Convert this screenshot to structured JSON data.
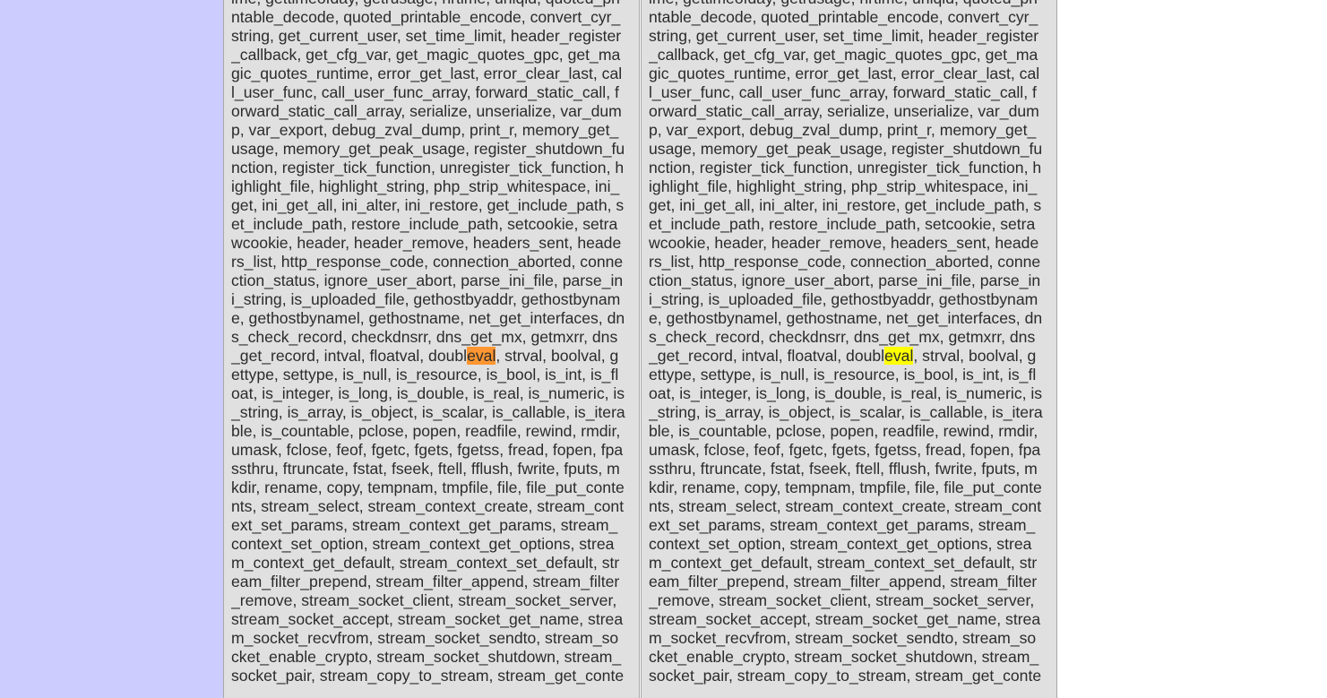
{
  "find": {
    "term": "eval"
  },
  "colors": {
    "page_left_background": "#ccccff",
    "panel_background": "#e0e0e0",
    "current_match_highlight": "#ff9632",
    "other_match_highlight": "#ffff00"
  },
  "left_panel": {
    "lines_before_match": [
      "ime, gettimeofday, getrusage, hrtime, uniqid, quoted_pri",
      "ntable_decode, quoted_printable_encode, convert_cyr_",
      "string, get_current_user, set_time_limit, header_register",
      "_callback, get_cfg_var, get_magic_quotes_gpc, get_ma",
      "gic_quotes_runtime, error_get_last, error_clear_last, cal",
      "l_user_func, call_user_func_array, forward_static_call, f",
      "orward_static_call_array, serialize, unserialize, var_dum",
      "p, var_export, debug_zval_dump, print_r, memory_get_",
      "usage, memory_get_peak_usage, register_shutdown_fu",
      "nction, register_tick_function, unregister_tick_function, h",
      "ighlight_file, highlight_string, php_strip_whitespace, ini_",
      "get, ini_get_all, ini_alter, ini_restore, get_include_path, s",
      "et_include_path, restore_include_path, setcookie, setra",
      "wcookie, header, header_remove, headers_sent, heade",
      "rs_list, http_response_code, connection_aborted, conne",
      "ction_status, ignore_user_abort, parse_ini_file, parse_in",
      "i_string, is_uploaded_file, gethostbyaddr, gethostbynam",
      "e, gethostbynamel, gethostname, net_get_interfaces, dn",
      "s_check_record, checkdnsrr, dns_get_mx, getmxrr, dns"
    ],
    "match_line": {
      "before": "_get_record, intval, floatval, doubl",
      "match": "eval",
      "after": ", strval, boolval, g"
    },
    "lines_after_match": [
      "ettype, settype, is_null, is_resource, is_bool, is_int, is_fl",
      "oat, is_integer, is_long, is_double, is_real, is_numeric, is",
      "_string, is_array, is_object, is_scalar, is_callable, is_itera",
      "ble, is_countable, pclose, popen, readfile, rewind, rmdir,",
      "umask, fclose, feof, fgetc, fgets, fgetss, fread, fopen, fpa",
      "ssthru, ftruncate, fstat, fseek, ftell, fflush, fwrite, fputs, m",
      "kdir, rename, copy, tempnam, tmpfile, file, file_put_conte",
      "nts, stream_select, stream_context_create, stream_cont",
      "ext_set_params, stream_context_get_params, stream_",
      "context_set_option, stream_context_get_options, strea",
      "m_context_get_default, stream_context_set_default, str",
      "eam_filter_prepend, stream_filter_append, stream_filter",
      "_remove, stream_socket_client, stream_socket_server,",
      "stream_socket_accept, stream_socket_get_name, strea",
      "m_socket_recvfrom, stream_socket_sendto, stream_so",
      "cket_enable_crypto, stream_socket_shutdown, stream_",
      "socket_pair, stream_copy_to_stream, stream_get_conte"
    ]
  },
  "right_panel": {
    "lines_before_match": [
      "ime, gettimeofday, getrusage, hrtime, uniqid, quoted_pri",
      "ntable_decode, quoted_printable_encode, convert_cyr_",
      "string, get_current_user, set_time_limit, header_register",
      "_callback, get_cfg_var, get_magic_quotes_gpc, get_ma",
      "gic_quotes_runtime, error_get_last, error_clear_last, cal",
      "l_user_func, call_user_func_array, forward_static_call, f",
      "orward_static_call_array, serialize, unserialize, var_dum",
      "p, var_export, debug_zval_dump, print_r, memory_get_",
      "usage, memory_get_peak_usage, register_shutdown_fu",
      "nction, register_tick_function, unregister_tick_function, h",
      "ighlight_file, highlight_string, php_strip_whitespace, ini_",
      "get, ini_get_all, ini_alter, ini_restore, get_include_path, s",
      "et_include_path, restore_include_path, setcookie, setra",
      "wcookie, header, header_remove, headers_sent, heade",
      "rs_list, http_response_code, connection_aborted, conne",
      "ction_status, ignore_user_abort, parse_ini_file, parse_in",
      "i_string, is_uploaded_file, gethostbyaddr, gethostbynam",
      "e, gethostbynamel, gethostname, net_get_interfaces, dn",
      "s_check_record, checkdnsrr, dns_get_mx, getmxrr, dns"
    ],
    "match_line": {
      "before": "_get_record, intval, floatval, doubl",
      "match": "eval",
      "after": ", strval, boolval, g"
    },
    "lines_after_match": [
      "ettype, settype, is_null, is_resource, is_bool, is_int, is_fl",
      "oat, is_integer, is_long, is_double, is_real, is_numeric, is",
      "_string, is_array, is_object, is_scalar, is_callable, is_itera",
      "ble, is_countable, pclose, popen, readfile, rewind, rmdir,",
      "umask, fclose, feof, fgetc, fgets, fgetss, fread, fopen, fpa",
      "ssthru, ftruncate, fstat, fseek, ftell, fflush, fwrite, fputs, m",
      "kdir, rename, copy, tempnam, tmpfile, file, file_put_conte",
      "nts, stream_select, stream_context_create, stream_cont",
      "ext_set_params, stream_context_get_params, stream_",
      "context_set_option, stream_context_get_options, strea",
      "m_context_get_default, stream_context_set_default, str",
      "eam_filter_prepend, stream_filter_append, stream_filter",
      "_remove, stream_socket_client, stream_socket_server,",
      "stream_socket_accept, stream_socket_get_name, strea",
      "m_socket_recvfrom, stream_socket_sendto, stream_so",
      "cket_enable_crypto, stream_socket_shutdown, stream_",
      "socket_pair, stream_copy_to_stream, stream_get_conte"
    ]
  }
}
